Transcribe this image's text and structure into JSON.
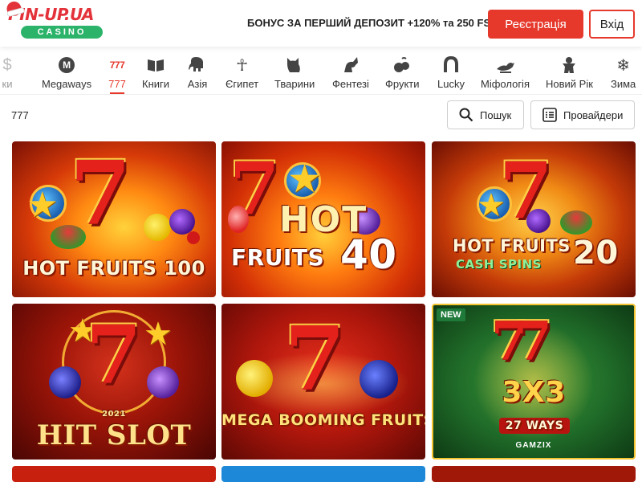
{
  "header": {
    "logo_text": "PIN-UP.UA",
    "logo_sub": "CASINO",
    "bonus": "БОНУС ЗА ПЕРШИЙ ДЕПОЗИТ +120% та 250 FS",
    "register_label": "Реєстрація",
    "login_label": "Вхід"
  },
  "categories": [
    {
      "label": "ки",
      "icon": "cut-off-icon"
    },
    {
      "label": "Megaways",
      "icon": "megaways-icon"
    },
    {
      "label": "777",
      "icon": "777-icon",
      "active": true
    },
    {
      "label": "Книги",
      "icon": "book-icon"
    },
    {
      "label": "Азія",
      "icon": "elephant-icon"
    },
    {
      "label": "Єгипет",
      "icon": "ankh-icon"
    },
    {
      "label": "Тварини",
      "icon": "cat-icon"
    },
    {
      "label": "Фентезі",
      "icon": "unicorn-icon"
    },
    {
      "label": "Фрукти",
      "icon": "fruits-icon"
    },
    {
      "label": "Lucky",
      "icon": "horseshoe-icon"
    },
    {
      "label": "Міфологія",
      "icon": "lamp-icon"
    },
    {
      "label": "Новий Рік",
      "icon": "gingerbread-icon"
    },
    {
      "label": "Зима",
      "icon": "snowflake-icon"
    }
  ],
  "filter": {
    "breadcrumb": "777",
    "search_label": "Пошук",
    "providers_label": "Провайдери"
  },
  "games": [
    {
      "title": "HOT FRUITS 100"
    },
    {
      "title_line1": "HOT",
      "title_line2": "FRUITS",
      "number": "40"
    },
    {
      "title": "HOT FRUITS",
      "subtitle": "CASH SPINS",
      "number": "20"
    },
    {
      "year": "2021",
      "title": "HIT SLOT"
    },
    {
      "title": "MEGA BOOMING FRUITS"
    },
    {
      "badge": "NEW",
      "title": "3X3",
      "subtitle": "27 WAYS",
      "provider": "GAMZIX"
    }
  ],
  "colors": {
    "accent": "#e6392c",
    "brand_green": "#2cb36a"
  }
}
